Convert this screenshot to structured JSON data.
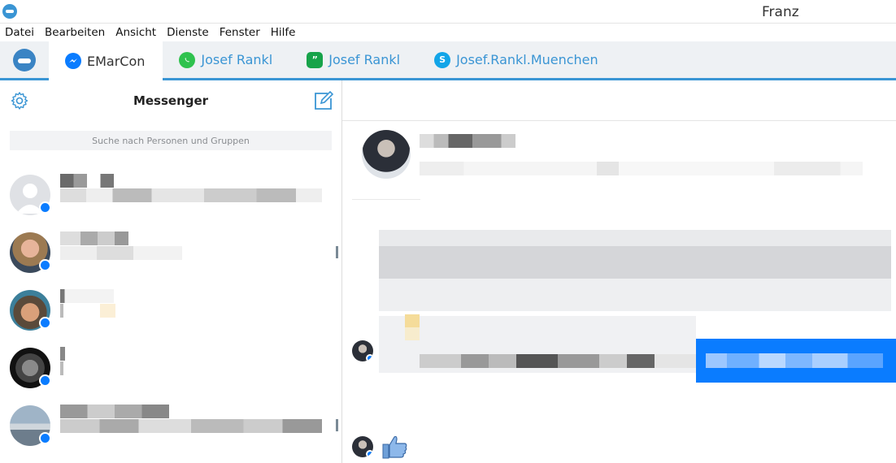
{
  "window": {
    "title": "Franz"
  },
  "menu": [
    "Datei",
    "Bearbeiten",
    "Ansicht",
    "Dienste",
    "Fenster",
    "Hilfe"
  ],
  "tabs": [
    {
      "label": "EMarCon",
      "service": "messenger",
      "icon": "messenger-icon",
      "active": true
    },
    {
      "label": "Josef Rankl",
      "service": "whatsapp",
      "icon": "whatsapp-icon",
      "active": false
    },
    {
      "label": "Josef Rankl",
      "service": "hangouts",
      "icon": "hangouts-icon",
      "active": false
    },
    {
      "label": "Josef.Rankl.Muenchen",
      "service": "skype",
      "icon": "skype-icon",
      "active": false
    }
  ],
  "sidebar": {
    "title": "Messenger",
    "search_placeholder": "Suche nach Personen und Gruppen",
    "contact_count": 5
  },
  "colors": {
    "accent": "#3a95d4",
    "messenger_blue": "#0a7cff",
    "tabbar_bg": "#eef1f4"
  }
}
